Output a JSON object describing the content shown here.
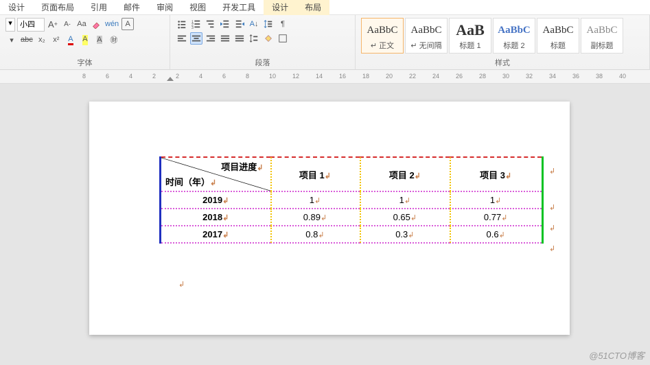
{
  "menubar": {
    "tabs": [
      "设计",
      "页面布局",
      "引用",
      "邮件",
      "审阅",
      "视图",
      "开发工具",
      "设计",
      "布局"
    ]
  },
  "ribbon": {
    "font": {
      "size_label": "小四",
      "grow": "A",
      "shrink": "A",
      "case": "Aa",
      "clear": "⌫",
      "phonetic": "wén",
      "charborder": "A",
      "strike": "abє",
      "sub": "x₂",
      "sup": "x²",
      "fontcolor": "A",
      "highlight": "A",
      "charshade": "A",
      "enclose": "㊖",
      "group_title": "字体"
    },
    "para": {
      "bul": "•",
      "num": "1",
      "multi": "≡",
      "outdent": "⇤",
      "indent": "⇥",
      "sort": "A↓",
      "ln": "↕",
      "showmarks": "¶",
      "alignL": "≡",
      "alignC": "≡",
      "alignR": "≡",
      "alignJ": "≡",
      "dist": "≡",
      "linesp": "↕",
      "shade": "▦",
      "border": "▭",
      "group_title": "段落"
    },
    "styles": {
      "group_title": "样式",
      "items": [
        {
          "preview": "AaBbC",
          "caption": "↵ 正文"
        },
        {
          "preview": "AaBbC",
          "caption": "↵ 无间隔"
        },
        {
          "preview": "AaB",
          "caption": "标题 1"
        },
        {
          "preview": "AaBbC",
          "caption": "标题 2"
        },
        {
          "preview": "AaBbC",
          "caption": "标题"
        },
        {
          "preview": "AaBbC",
          "caption": "副标题"
        }
      ]
    }
  },
  "ruler": {
    "numbers": [
      "8",
      "6",
      "4",
      "2",
      "2",
      "4",
      "6",
      "8",
      "10",
      "12",
      "14",
      "16",
      "18",
      "20",
      "22",
      "24",
      "26",
      "28",
      "30",
      "32",
      "34",
      "36",
      "38",
      "40"
    ]
  },
  "table": {
    "corner_top": "项目进度",
    "corner_bottom": "时间（年）",
    "headers": [
      "项目 1",
      "项目 2",
      "项目 3"
    ],
    "rows": [
      {
        "label": "2019",
        "cells": [
          "1",
          "1",
          "1"
        ]
      },
      {
        "label": "2018",
        "cells": [
          "0.89",
          "0.65",
          "0.77"
        ]
      },
      {
        "label": "2017",
        "cells": [
          "0.8",
          "0.3",
          "0.6"
        ]
      }
    ]
  },
  "chart_data": {
    "type": "table",
    "title": "项目进度 / 时间（年）",
    "columns": [
      "时间（年）",
      "项目 1",
      "项目 2",
      "项目 3"
    ],
    "rows": [
      [
        "2019",
        1,
        1,
        1
      ],
      [
        "2018",
        0.89,
        0.65,
        0.77
      ],
      [
        "2017",
        0.8,
        0.3,
        0.6
      ]
    ]
  },
  "watermark": "@51CTO博客"
}
